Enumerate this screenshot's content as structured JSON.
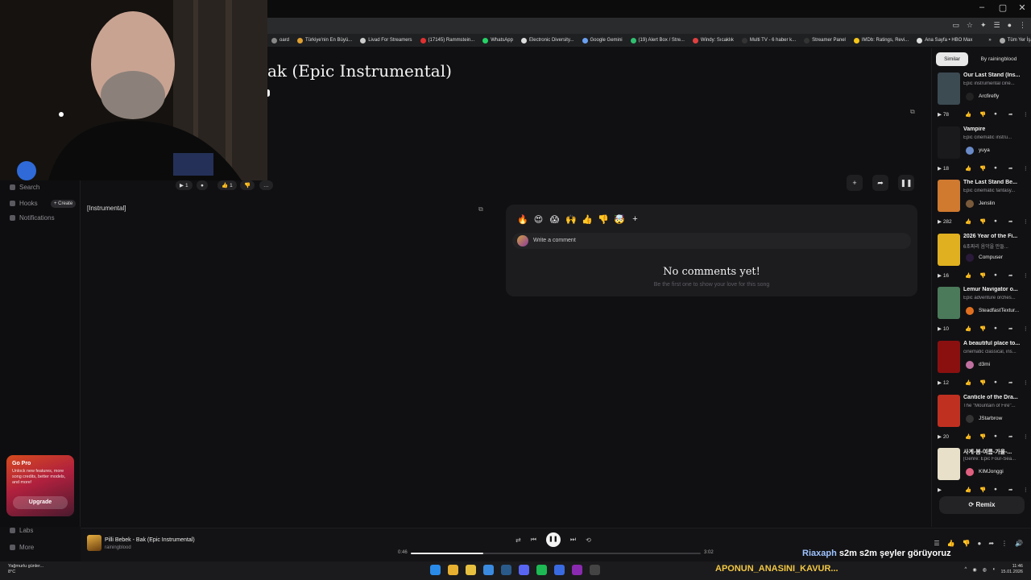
{
  "browser": {
    "bookmarks": [
      {
        "label": "oard",
        "color": "#888888"
      },
      {
        "label": "Türkiye'nin En Büyü...",
        "color": "#e0a030"
      },
      {
        "label": "Livad For Streamers",
        "color": "#cccccc"
      },
      {
        "label": "(17145) Rammstein...",
        "color": "#e03030"
      },
      {
        "label": "WhatsApp",
        "color": "#25d366"
      },
      {
        "label": "Electronic Diversity...",
        "color": "#dddddd"
      },
      {
        "label": "Google Gemini",
        "color": "#6aa0f0"
      },
      {
        "label": "(19) Alert Box / Stre...",
        "color": "#30c070"
      },
      {
        "label": "Windy: Sıcaklık",
        "color": "#e04040"
      },
      {
        "label": "Multi TV - 6 haber k...",
        "color": "#333333"
      },
      {
        "label": "Streamer Panel",
        "color": "#333333"
      },
      {
        "label": "IMDb: Ratings, Revi...",
        "color": "#f5c518"
      },
      {
        "label": "Ana Sayfa • HBO Max",
        "color": "#dddddd"
      },
      {
        "label": "»",
        "color": "#1f2022"
      },
      {
        "label": "Tüm Yer İşaretleri",
        "color": "#aaaaaa"
      }
    ]
  },
  "nav": {
    "search": "Search",
    "hooks": "Hooks",
    "create": "+ Create",
    "notifications": "Notifications",
    "labs": "Labs",
    "more": "More"
  },
  "promo": {
    "title": "Go Pro",
    "desc": "Unlock new features, more song credits, better models, and more!",
    "button": "Upgrade"
  },
  "song": {
    "title": "ak (Epic Instrumental)",
    "plays": "1",
    "likes": "1",
    "lyrics": "[Instrumental]"
  },
  "comments": {
    "reactions": [
      "🔥",
      "😍",
      "😱",
      "🙌",
      "👍",
      "👎",
      "🤯",
      "+"
    ],
    "placeholder": "Write a comment",
    "empty_title": "No comments yet!",
    "empty_sub": "Be the first one to show your love for this song"
  },
  "sidebar": {
    "tab_similar": "Similar",
    "tab_by": "By rainingblood",
    "items": [
      {
        "title": "Our Last Stand (Ins...",
        "desc": "Epic instrumental cine...",
        "artist": "Arcfirefly",
        "plays": "78",
        "thumb": "#3c4a52",
        "avatar": "#222222"
      },
      {
        "title": "Vampire",
        "desc": "Epic cinematic instru...",
        "artist": "yuya",
        "plays": "18",
        "thumb": "#1a1a1c",
        "avatar": "#6a8ac8"
      },
      {
        "title": "The Last Stand Be...",
        "desc": "Epic cinematic fantasy...",
        "artist": "Jenslin",
        "plays": "282",
        "thumb": "#d07a30",
        "avatar": "#7a5a3a"
      },
      {
        "title": "2026 Year of the Fi...",
        "desc": "6초짜리 음악을 만들...",
        "artist": "Compuser",
        "plays": "16",
        "thumb": "#e0b020",
        "avatar": "#2a1a3a"
      },
      {
        "title": "Lemur Navigator o...",
        "desc": "Epic adventure orches...",
        "artist": "SteadfastTextur...",
        "plays": "10",
        "thumb": "#4a7a5a",
        "avatar": "#e07020"
      },
      {
        "title": "A beautiful place to...",
        "desc": "cinematic classical, ins...",
        "artist": "d3mi",
        "plays": "12",
        "thumb": "#8a1010",
        "avatar": "#c070a0"
      },
      {
        "title": "Canticle of the Dra...",
        "desc": "The \"Mountain of Fire\"...",
        "artist": "JStarbrow",
        "plays": "20",
        "thumb": "#c03020",
        "avatar": "#333333"
      },
      {
        "title": "사계-봄-여름-가을-...",
        "desc": "[Genre: Epic Four-Sea...",
        "artist": "KIMJonggi",
        "plays": "",
        "thumb": "#e8e0c8",
        "avatar": "#e06080"
      }
    ],
    "remix": "Remix"
  },
  "player": {
    "title": "Pilli Bebek - Bak (Epic Instrumental)",
    "artist": "rainingblood",
    "current": "0:46",
    "total": "3:02",
    "progress": 0.25
  },
  "chat": {
    "user": "Riaxaph",
    "message": "s2m s2m şeyler görüyoruz",
    "user_color": "#9ec3ff",
    "msg_color": "#ffffff"
  },
  "taskbar": {
    "weather_title": "Yağmurlu günler...",
    "weather_temp": "8°C",
    "marquee": "APONUN_ANASINI_KAVUR...",
    "time": "11:46",
    "date": "15.01.2026"
  }
}
